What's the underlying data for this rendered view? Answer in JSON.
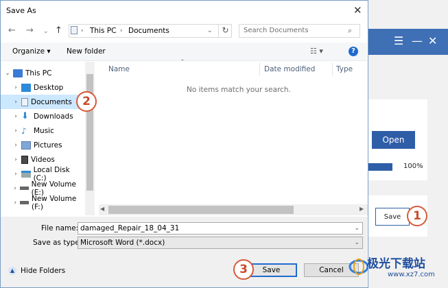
{
  "dialog": {
    "title": "Save As",
    "close": "✕",
    "breadcrumb": [
      "This PC",
      "Documents"
    ],
    "search_placeholder": "Search Documents",
    "toolbar": {
      "organize": "Organize ▾",
      "new_folder": "New folder"
    },
    "tree": [
      {
        "label": "This PC",
        "icon": "pc-icon"
      },
      {
        "label": "Desktop",
        "icon": "desktop-icon"
      },
      {
        "label": "Documents",
        "icon": "documents-icon",
        "selected": true
      },
      {
        "label": "Downloads",
        "icon": "downloads-icon"
      },
      {
        "label": "Music",
        "icon": "music-icon"
      },
      {
        "label": "Pictures",
        "icon": "pictures-icon"
      },
      {
        "label": "Videos",
        "icon": "videos-icon"
      },
      {
        "label": "Local Disk (C:)",
        "icon": "disk-icon"
      },
      {
        "label": "New Volume (E:)",
        "icon": "drive-icon"
      },
      {
        "label": "New Volume (F:)",
        "icon": "drive-icon"
      }
    ],
    "columns": [
      "Name",
      "Date modified",
      "Type"
    ],
    "empty_message": "No items match your search.",
    "file_name_label": "File name:",
    "file_name_value": "damaged_Repair_18_04_31",
    "save_as_type_label": "Save as type:",
    "save_as_type_value": "Microsoft Word (*.docx)",
    "hide_folders": "Hide Folders",
    "save_button": "Save",
    "cancel_button": "Cancel"
  },
  "background_app": {
    "open_button": "Open",
    "progress_percent": 100,
    "progress_label": "100%",
    "save_button": "Save"
  },
  "badges": [
    "1",
    "2",
    "3"
  ],
  "watermark": {
    "text": "极光下载站",
    "url": "www.xz7.com"
  }
}
